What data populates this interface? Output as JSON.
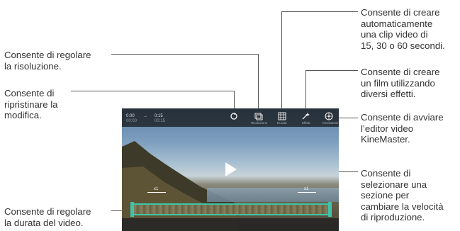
{
  "callouts": {
    "resolution": [
      "Consente di regolare",
      "la risoluzione."
    ],
    "restore": [
      "Consente di",
      "ripristinare la",
      "modifica."
    ],
    "duration": [
      "Consente di regolare",
      "la durata del video."
    ],
    "auto_clip": [
      "Consente di creare",
      "automaticamente",
      "una clip video di",
      "15, 30 o 60 secondi."
    ],
    "effects": [
      "Consente di creare",
      "un film utilizzando",
      "diversi effetti."
    ],
    "kinemaster": [
      "Consente di avviare",
      "l’editor video",
      "KineMaster."
    ],
    "speed": [
      "Consente di",
      "selezionare una",
      "sezione per",
      "cambiare la velocità",
      "di riproduzione."
    ]
  },
  "screen": {
    "topbar": {
      "time_start": "0:00",
      "arrow": "→",
      "time_end": "0:15",
      "time_sub_start": "00:00",
      "time_sub_end": "00:15",
      "icons": [
        "restore-icon",
        "resolution-icon",
        "auto-clip-icon",
        "effects-icon",
        "kinemaster-icon"
      ],
      "labels": [
        "",
        "Risoluzione",
        "Durata",
        "Effetti",
        "KineMaster"
      ]
    },
    "speed_markers": {
      "left": "x1",
      "right": "x1"
    }
  }
}
